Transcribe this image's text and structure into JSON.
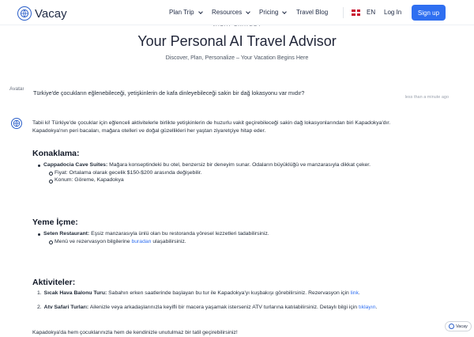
{
  "header": {
    "brand": "Vacay",
    "nav": [
      {
        "label": "Plan Trip"
      },
      {
        "label": "Resources"
      },
      {
        "label": "Pricing"
      },
      {
        "label": "Travel Blog"
      }
    ],
    "language": "EN",
    "login": "Log In",
    "signup": "Sign up",
    "accent_color": "#2f6ff1"
  },
  "hero": {
    "eyebrow": "VACAY CHATBOT",
    "title": "Your Personal AI Travel Advisor",
    "subtitle": "Discover, Plan, Personalize – Your Vacation Begins Here"
  },
  "chat": {
    "user_avatar_alt": "Avatar",
    "user_message": "Türkiye'de çocukların eğlenebileceği, yetişkinlerin de kafa dinleyebileceği sakin bir dağ lokasyonu var mıdır?",
    "timestamp": "less than a minute ago",
    "answer_intro_1": "Tabii ki! Türkiye'de çocuklar için eğlenceli aktivitelerle birlikte yetişkinlerin de huzurlu vakit geçirebileceği sakin dağ lokasyonlarından biri Kapadokya'dır.",
    "answer_intro_2": "Kapadokya'nın peri bacaları, mağara otelleri ve doğal güzellikleri her yaştan ziyaretçiye hitap eder.",
    "accommodation": {
      "heading": "Konaklama:",
      "name": "Cappadocia Cave Suites:",
      "desc": "Mağara konseptindeki bu otel, benzersiz bir deneyim sunar. Odaların büyüklüğü ve manzarasıyla dikkat çeker.",
      "price": "Fiyat: Ortalama olarak gecelik $150-$200 arasında değişebilir.",
      "location": "Konum: Göreme, Kapadokya"
    },
    "food": {
      "heading": "Yeme İçme:",
      "name": "Seten Restaurant:",
      "desc": "Eşsiz manzarasıyla ünlü olan bu restoranda yöresel lezzetleri tadabilirsiniz.",
      "menu_pre": "Menü ve rezervasyon bilgilerine",
      "menu_link": "buradan",
      "menu_post": "ulaşabilirsiniz."
    },
    "activities": {
      "heading": "Aktiviteler:",
      "items": [
        {
          "num": "1.",
          "name": "Sıcak Hava Balonu Turu:",
          "desc": "Sabahın erken saatlerinde başlayan bu tur ile Kapadokya'yı kuşbakışı görebilirsiniz. Rezervasyon için",
          "link": "link",
          "post": "."
        },
        {
          "num": "2.",
          "name": "Atv Safari Turları:",
          "desc": "Ailenizle veya arkadaşlarınızla keyifli bir macera yaşamak isterseniz ATV turlarına katılabilirsiniz. Detaylı bilgi için",
          "link": "tıklayın",
          "post": "."
        }
      ]
    },
    "closing": "Kapadokya'da hem çocuklarınızla hem de kendinizle unutulmaz bir tatil geçirebilirsiniz!"
  },
  "badge": {
    "label": "Vacay"
  }
}
